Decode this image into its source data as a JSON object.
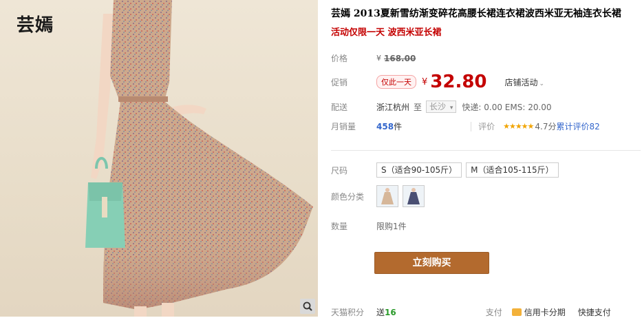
{
  "brand": "芸嫣",
  "title": "芸嫣 2013夏新雪纺渐变碎花高腰长裙连衣裙波西米亚无袖连衣长裙",
  "promo": "活动仅限一天 波西米亚长裙",
  "price": {
    "label": "价格",
    "currency": "¥",
    "original": "168.00"
  },
  "promo_price": {
    "label": "促销",
    "tag": "仅此一天",
    "currency": "¥",
    "value": "32.80",
    "shop_activity": "店铺活动"
  },
  "delivery": {
    "label": "配送",
    "from": "浙江杭州",
    "to_word": "至",
    "city": "长沙",
    "fees": "快递: 0.00 EMS: 20.00"
  },
  "sales": {
    "label": "月销量",
    "count": "458",
    "unit": "件",
    "review_label": "评价",
    "stars": "★★★★★",
    "rating": "4.7分",
    "review_text": "累计评价",
    "review_count": "82"
  },
  "size": {
    "label": "尺码",
    "options": [
      "S（适合90-105斤）",
      "M（适合105-115斤）"
    ]
  },
  "color": {
    "label": "颜色分类"
  },
  "quantity": {
    "label": "数量",
    "limit": "限购1件"
  },
  "buy_label": "立刻购买",
  "bottom": {
    "points_label": "天猫积分",
    "send": "送",
    "points": "16",
    "pay_label": "支付",
    "credit": "信用卡分期",
    "quick": "快捷支付"
  },
  "colors": {
    "price_red": "#c40000",
    "buy_button": "#b36a2e",
    "stars": "#f1a400",
    "link_blue": "#3366cc"
  },
  "icons": [
    "zoom-icon",
    "chevron-down-icon",
    "credit-card-icon"
  ]
}
